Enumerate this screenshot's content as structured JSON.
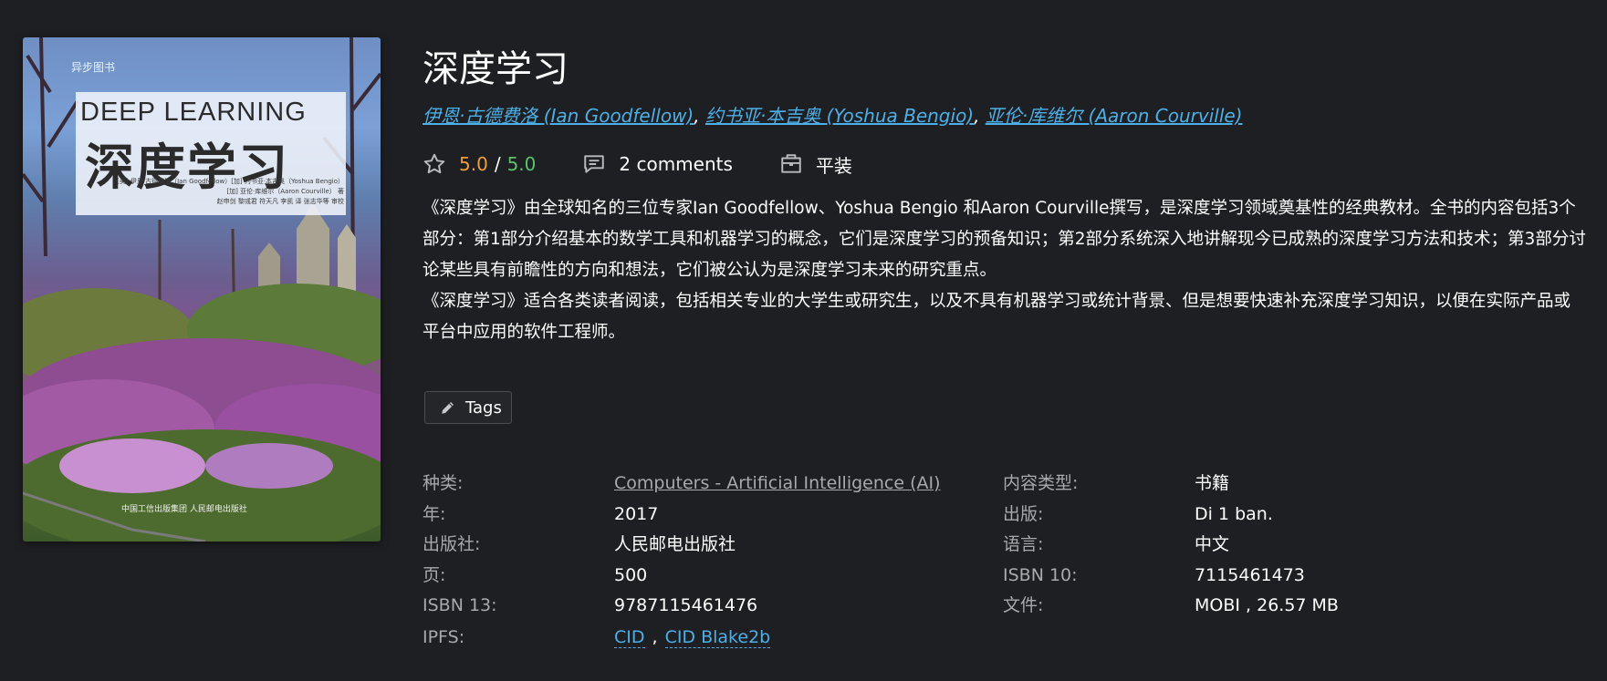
{
  "book": {
    "title": "深度学习",
    "authors": [
      {
        "name": "伊恩·古德费洛 (Ian Goodfellow)"
      },
      {
        "name": "约书亚·本吉奥 (Yoshua Bengio)"
      },
      {
        "name": "亚伦·库维尔 (Aaron Courville)"
      }
    ],
    "author_separator": ", ",
    "rating_value": "5.0",
    "rating_separator": "/",
    "rating_max": "5.0",
    "comments_label": "2 comments",
    "format": "平装",
    "description_p1": "《深度学习》由全球知名的三位专家Ian Goodfellow、Yoshua Bengio 和Aaron Courville撰写，是深度学习领域奠基性的经典教材。全书的内容包括3个部分：第1部分介绍基本的数学工具和机器学习的概念，它们是深度学习的预备知识；第2部分系统深入地讲解现今已成熟的深度学习方法和技术；第3部分讨论某些具有前瞻性的方向和想法，它们被公认为是深度学习未来的研究重点。",
    "description_p2": "《深度学习》适合各类读者阅读，包括相关专业的大学生或研究生，以及不具有机器学习或统计背景、但是想要快速补充深度学习知识，以便在实际产品或平台中应用的软件工程师。",
    "tags_label": "Tags"
  },
  "cover": {
    "publisher_logo": "异步图书",
    "title_en": "DEEP LEARNING",
    "title_cn": "深度学习",
    "authors_line1": "[美] 伊恩·古德费洛（Ian Goodfellow）[加] 约书亚·本吉奥（Yoshua Bengio）",
    "authors_line2": "[加] 亚伦·库维尔（Aaron Courville） 著",
    "authors_line3": "赵申剑 黎彧君 符天凡 李凯 译 张志华等 审校",
    "bottom_text": "中国工信出版集团     人民邮电出版社"
  },
  "details": {
    "category_label": "种类:",
    "category_value": "Computers - Artificial Intelligence (AI)",
    "content_type_label": "内容类型:",
    "content_type_value": "书籍",
    "year_label": "年:",
    "year_value": "2017",
    "edition_label": "出版:",
    "edition_value": "Di 1 ban.",
    "publisher_label": "出版社:",
    "publisher_value": "人民邮电出版社",
    "language_label": "语言:",
    "language_value": "中文",
    "pages_label": "页:",
    "pages_value": "500",
    "isbn10_label": "ISBN 10:",
    "isbn10_value": "7115461473",
    "isbn13_label": "ISBN 13:",
    "isbn13_value": "9787115461476",
    "file_label": "文件:",
    "file_value": "MOBI , 26.57 MB",
    "ipfs_label": "IPFS:",
    "ipfs_cid": "CID",
    "ipfs_separator": ",",
    "ipfs_cid_blake": "CID Blake2b"
  },
  "colors": {
    "background": "#1e1f23",
    "link": "#4bb0e6",
    "rating_value": "#f0a030",
    "rating_max": "#5bc26b",
    "label": "#a8a9ad"
  },
  "icons": {
    "rating": "star-outline-icon",
    "comments": "speech-bubble-icon",
    "format": "briefcase-icon",
    "tags": "pencil-icon"
  }
}
